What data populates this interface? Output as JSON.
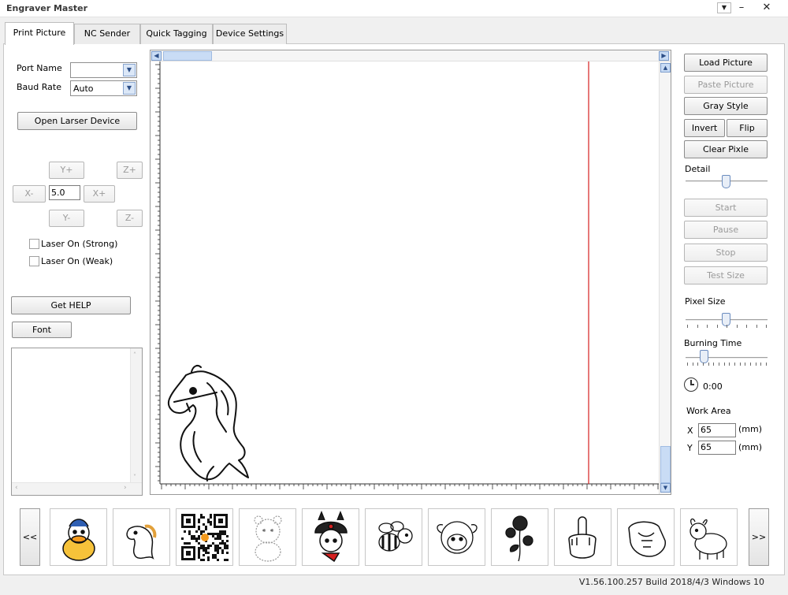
{
  "window": {
    "title": "Engraver Master"
  },
  "tabs": [
    {
      "label": "Print Picture"
    },
    {
      "label": "NC Sender"
    },
    {
      "label": "Quick Tagging"
    },
    {
      "label": "Device Settings"
    }
  ],
  "left": {
    "port_name_label": "Port Name",
    "port_name_value": "",
    "baud_rate_label": "Baud Rate",
    "baud_rate_value": "Auto",
    "open_device": "Open Larser Device",
    "y_plus": "Y+",
    "z_plus": "Z+",
    "x_minus": "X-",
    "step_value": "5.0",
    "x_plus": "X+",
    "y_minus": "Y-",
    "z_minus": "Z-",
    "laser_strong": "Laser On (Strong)",
    "laser_weak": "Laser On (Weak)",
    "get_help": "Get HELP",
    "font": "Font"
  },
  "right": {
    "load_picture": "Load Picture",
    "paste_picture": "Paste Picture",
    "gray_style": "Gray Style",
    "invert": "Invert",
    "flip": "Flip",
    "clear_pixle": "Clear Pixle",
    "detail_label": "Detail",
    "detail_level": 0.5,
    "start": "Start",
    "pause": "Pause",
    "stop": "Stop",
    "test_size": "Test Size",
    "pixel_size_label": "Pixel Size",
    "pixel_size_level": 0.5,
    "burning_time_label": "Burning Time",
    "burning_time_level": 0.2,
    "timer": "0:00",
    "work_area_label": "Work Area",
    "x_label": "X",
    "x_value": "65",
    "x_unit": "(mm)",
    "y_label": "Y",
    "y_value": "65",
    "y_unit": "(mm)"
  },
  "thumbnails": {
    "prev": "<<",
    "next": ">>",
    "items": [
      "duck-drawing",
      "horse-drawing",
      "qr-code",
      "bear-drawing",
      "bunny-hat-drawing",
      "bee-drawing",
      "sheep-drawing",
      "rose-drawing",
      "hand-gesture-drawing",
      "pointing-fist-drawing",
      "cow-drawing"
    ]
  },
  "status": {
    "version": "V1.56.100.257 Build 2018/4/3 Windows 10"
  },
  "colors": {
    "accent_line": "#d52020",
    "scroll_blue": "#c9dcf5"
  }
}
